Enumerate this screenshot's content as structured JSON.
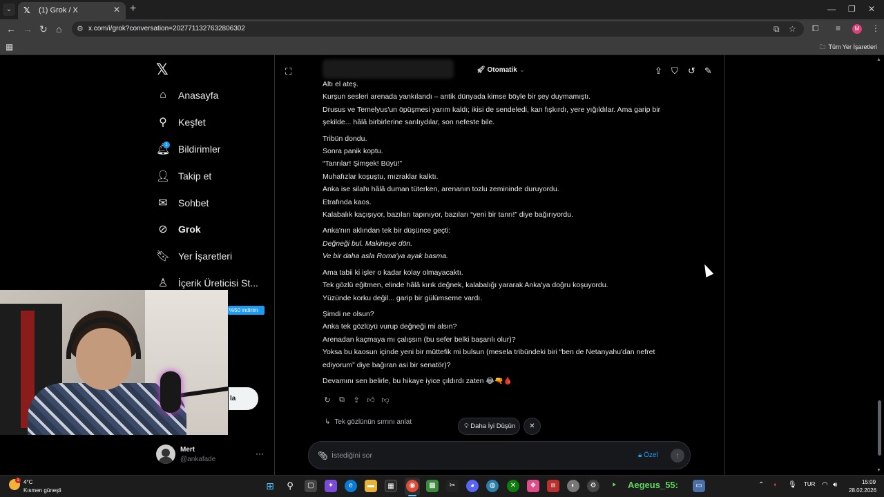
{
  "browser": {
    "tab_title": "(1) Grok / X",
    "url": "x.com/i/grok?conversation=2027711327632806302",
    "bookmark_folder": "Tüm Yer İşaretleri",
    "profile_initial": "M"
  },
  "sidebar": {
    "items": [
      {
        "label": "Anasayfa",
        "icon": "home-icon"
      },
      {
        "label": "Keşfet",
        "icon": "search-icon"
      },
      {
        "label": "Bildirimler",
        "icon": "bell-icon"
      },
      {
        "label": "Takip et",
        "icon": "follow-icon"
      },
      {
        "label": "Sohbet",
        "icon": "mail-icon"
      },
      {
        "label": "Grok",
        "icon": "grok-icon"
      },
      {
        "label": "Yer İşaretleri",
        "icon": "bookmark-icon"
      },
      {
        "label": "İçerik Üreticisi St...",
        "icon": "creator-icon"
      }
    ],
    "notification_count": "1",
    "promo_badge": "%50 indirim",
    "post_button_fragment": "la",
    "user": {
      "name": "Mert",
      "handle": "@ankafade"
    }
  },
  "grok": {
    "mode": "Otomatik",
    "story_paragraphs": [
      {
        "lines": [
          "Altı el ateş.",
          "Kurşun sesleri arenada yankılandı – antik dünyada kimse böyle bir şey duymamıştı.",
          "Drusus ve Temelyus'un öpüşmesi yarım kaldı; ikisi de sendeledi, kan fışkırdı, yere yığıldılar. Ama garip bir şekilde... hâlâ birbirlerine sarılıydılar, son nefeste bile."
        ]
      },
      {
        "lines": [
          "Tribün dondu.",
          "Sonra panik koptu.",
          "“Tanrılar! Şimşek! Büyü!”",
          "Muhafızlar koşuştu, mızraklar kalktı.",
          "Anka ise silahı hâlâ duman tüterken, arenanın tozlu zemininde duruyordu.",
          "Etrafında kaos.",
          "Kalabalık kaçışıyor, bazıları tapınıyor, bazıları “yeni bir tanrı!” diye bağırıyordu."
        ]
      },
      {
        "lines": [
          "Anka'nın aklından tek bir düşünce geçti:",
          "Değneği bul. Makineye dön.",
          "Ve bir daha asla Roma'ya ayak basma."
        ],
        "italic_from": 1
      },
      {
        "lines": [
          "Ama tabii ki işler o kadar kolay olmayacaktı.",
          "Tek gözlü eğitmen, elinde hâlâ kırık değnek, kalabalığı yararak Anka'ya doğru koşuyordu.",
          "Yüzünde korku değil... garip bir gülümseme vardı."
        ]
      },
      {
        "lines": [
          "Şimdi ne olsun?",
          "Anka tek gözlüyü vurup değneği mi alsın?",
          "Arenadan kaçmaya mı çalışsın (bu sefer belki başarılı olur)?",
          "Yoksa bu kaosun içinde yeni bir müttefik mi bulsun (mesela tribündeki biri “ben de Netanyahu'dan nefret ediyorum” diye bağıran asi bir senatör)?"
        ]
      },
      {
        "lines": [
          "Devamını sen belirle, bu hikaye iyice çıldırdı zaten 😂🔫🩸"
        ]
      }
    ],
    "suggestion": "Tek gözlünün sırrını anlat",
    "think_button": "Daha İyi Düşün",
    "composer_placeholder": "İstediğini sor",
    "privacy_label": "Özel"
  },
  "taskbar": {
    "temperature": "4°C",
    "weather": "Kısmen güneşli",
    "weather_badge": "1",
    "user_label": "Aegeus_55:",
    "language": "TUR",
    "time": "15:09",
    "date": "28.02.2026"
  },
  "colors": {
    "accent": "#1d9bf0",
    "background": "#000000",
    "text": "#e7e9ea",
    "muted": "#71767b"
  }
}
